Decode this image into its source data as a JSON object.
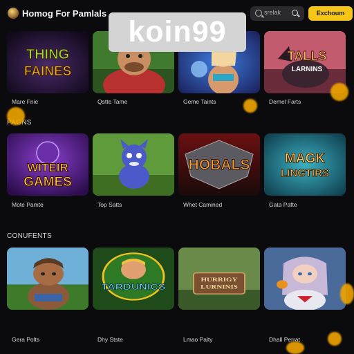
{
  "header": {
    "logo_icon": "game-controller-logo",
    "site_title": "Homog For Pamlals",
    "search_placeholder": "srelak",
    "cta_label": "Exchoum"
  },
  "watermark": {
    "text": "koin99"
  },
  "sections": [
    {
      "label": ""
    },
    {
      "label": "PAGNS"
    },
    {
      "label": "CONUFENTS"
    }
  ],
  "tiles": [
    {
      "title": "Mare Fnie",
      "art_text": [
        "THING",
        "FAINES"
      ]
    },
    {
      "title": "Qstte Tame",
      "art_text": []
    },
    {
      "title": "Geme Taints",
      "art_text": []
    },
    {
      "title": "Demel Farts",
      "art_text": [
        "TALLS",
        "LARNINS"
      ]
    },
    {
      "title": "Mote Pamte",
      "art_text": [
        "WITEIR",
        "GAMES"
      ]
    },
    {
      "title": "Top Satts",
      "art_text": []
    },
    {
      "title": "Whet Camined",
      "art_text": [
        "HOBALS"
      ]
    },
    {
      "title": "Gata Pafte",
      "art_text": [
        "MAGK",
        "LINGTIRS"
      ]
    },
    {
      "title": "Gera Polts",
      "art_text": []
    },
    {
      "title": "Dhy Stste",
      "art_text": [
        "TARDUNICS"
      ]
    },
    {
      "title": "Lmao Palty",
      "art_text": [
        "HURRIGY",
        "LURNINIS"
      ]
    },
    {
      "title": "Dhall Perrat",
      "art_text": []
    }
  ],
  "colors": {
    "accent": "#f5c518",
    "background": "#0b0b0d"
  }
}
